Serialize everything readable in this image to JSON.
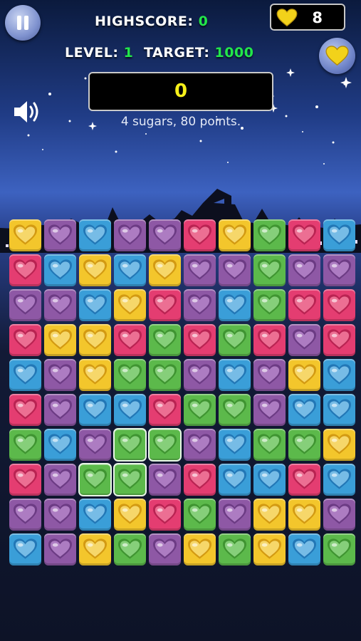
{
  "hud": {
    "highscore_label": "HIGHSCORE:",
    "highscore_value": "0",
    "level_label": "LEVEL:",
    "level_value": "1",
    "target_label": "TARGET:",
    "target_value": "1000",
    "coins": "8",
    "score": "0",
    "status": "4 sugars, 80 points."
  },
  "icons": {
    "pause": "pause-icon",
    "coin": "heart-coin-icon",
    "shop": "heart-coin-icon",
    "sound": "speaker-icon",
    "moon": "crescent-moon"
  },
  "colors": {
    "yellow": "#f3c62c",
    "purple": "#8e58a5",
    "blue": "#3a9ed8",
    "pink": "#e43d71",
    "green": "#5cb94b",
    "counter_green": "#22e64a",
    "score_yellow": "#f6f01a"
  },
  "board": {
    "rows": [
      [
        "yellow",
        "purple",
        "blue",
        "purple",
        "purple",
        "pink",
        "yellow",
        "green",
        "pink",
        "blue"
      ],
      [
        "pink",
        "blue",
        "yellow",
        "blue",
        "yellow",
        "purple",
        "purple",
        "green",
        "purple",
        "purple"
      ],
      [
        "purple",
        "purple",
        "blue",
        "yellow",
        "pink",
        "purple",
        "blue",
        "green",
        "pink",
        "pink"
      ],
      [
        "pink",
        "yellow",
        "yellow",
        "pink",
        "green",
        "pink",
        "green",
        "pink",
        "purple",
        "pink"
      ],
      [
        "blue",
        "purple",
        "yellow",
        "green",
        "green",
        "purple",
        "blue",
        "purple",
        "yellow",
        "blue"
      ],
      [
        "pink",
        "purple",
        "blue",
        "blue",
        "pink",
        "green",
        "green",
        "purple",
        "blue",
        "blue"
      ],
      [
        "green",
        "blue",
        "purple",
        "green",
        "green",
        "purple",
        "blue",
        "green",
        "green",
        "yellow"
      ],
      [
        "pink",
        "purple",
        "green",
        "green",
        "purple",
        "pink",
        "blue",
        "blue",
        "pink",
        "blue"
      ],
      [
        "purple",
        "purple",
        "blue",
        "yellow",
        "pink",
        "green",
        "purple",
        "yellow",
        "yellow",
        "purple"
      ],
      [
        "blue",
        "purple",
        "yellow",
        "green",
        "purple",
        "yellow",
        "green",
        "yellow",
        "blue",
        "green"
      ]
    ],
    "selected": [
      [
        6,
        3
      ],
      [
        6,
        4
      ],
      [
        7,
        2
      ],
      [
        7,
        3
      ]
    ]
  }
}
